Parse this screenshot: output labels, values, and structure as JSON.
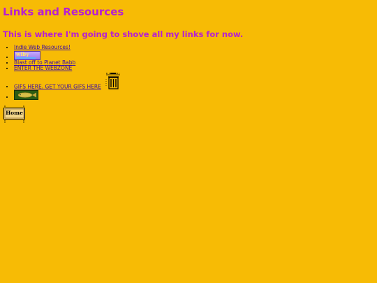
{
  "page": {
    "title": "Links and Resources",
    "subtitle": "This is where I'm going to shove all my links for now."
  },
  "links": {
    "indie_web": "Indie Web Resources!",
    "wiby_badge_text": "wiby",
    "planet_babb": "Blast off to Planet Babb",
    "webzone": "ENTER THE WEBZONE",
    "gifs": "GIFS HERE. GET YOUR GIFS HERE"
  },
  "home_button": {
    "label": "Home"
  },
  "colors": {
    "background": "#f7bb05",
    "heading": "#b71fd1",
    "link": "#3a0aa8"
  },
  "icons": {
    "wiby": "wiby-badge-icon",
    "trash": "trash-can-icon",
    "fish": "fish-badge-icon",
    "home": "home-sign-icon"
  }
}
